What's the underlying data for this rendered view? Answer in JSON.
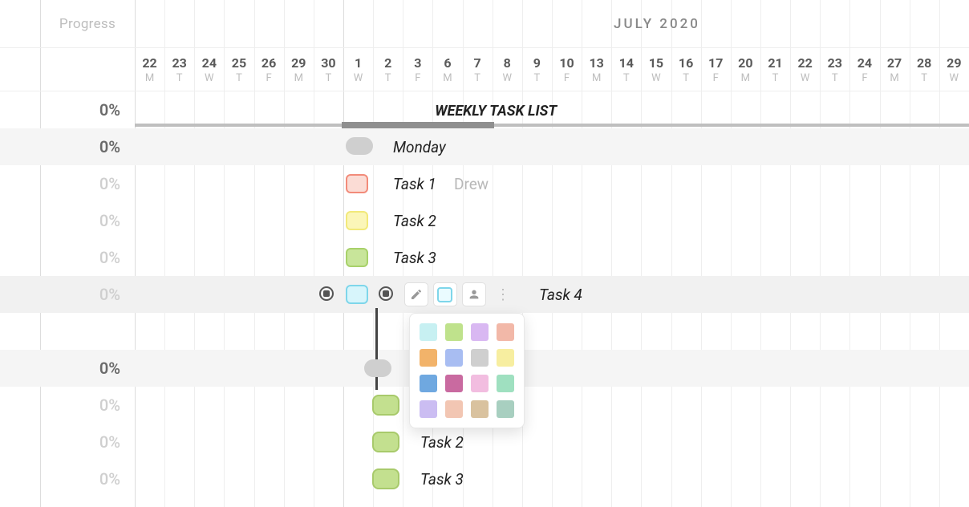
{
  "header": {
    "progress_label": "Progress",
    "month_label": "JULY 2020"
  },
  "dates": [
    {
      "num": "22",
      "dow": "M"
    },
    {
      "num": "23",
      "dow": "T"
    },
    {
      "num": "24",
      "dow": "W"
    },
    {
      "num": "25",
      "dow": "T"
    },
    {
      "num": "26",
      "dow": "F"
    },
    {
      "num": "29",
      "dow": "M"
    },
    {
      "num": "30",
      "dow": "T"
    },
    {
      "num": "1",
      "dow": "W"
    },
    {
      "num": "2",
      "dow": "T"
    },
    {
      "num": "3",
      "dow": "F"
    },
    {
      "num": "6",
      "dow": "M"
    },
    {
      "num": "7",
      "dow": "T"
    },
    {
      "num": "8",
      "dow": "W"
    },
    {
      "num": "9",
      "dow": "T"
    },
    {
      "num": "10",
      "dow": "F"
    },
    {
      "num": "13",
      "dow": "M"
    },
    {
      "num": "14",
      "dow": "T"
    },
    {
      "num": "15",
      "dow": "W"
    },
    {
      "num": "16",
      "dow": "T"
    },
    {
      "num": "17",
      "dow": "F"
    },
    {
      "num": "20",
      "dow": "M"
    },
    {
      "num": "21",
      "dow": "T"
    },
    {
      "num": "22",
      "dow": "W"
    },
    {
      "num": "23",
      "dow": "T"
    },
    {
      "num": "24",
      "dow": "F"
    },
    {
      "num": "27",
      "dow": "M"
    },
    {
      "num": "28",
      "dow": "T"
    },
    {
      "num": "29",
      "dow": "W"
    }
  ],
  "rows": [
    {
      "progress": "0%",
      "faded": false,
      "shade": false
    },
    {
      "progress": "0%",
      "faded": false,
      "shade": true
    },
    {
      "progress": "0%",
      "faded": true,
      "shade": false
    },
    {
      "progress": "0%",
      "faded": true,
      "shade": false
    },
    {
      "progress": "0%",
      "faded": true,
      "shade": false
    },
    {
      "progress": "0%",
      "faded": true,
      "shade": false
    },
    {
      "progress": "",
      "faded": true,
      "shade": false
    },
    {
      "progress": "0%",
      "faded": false,
      "shade": true
    },
    {
      "progress": "0%",
      "faded": true,
      "shade": false
    },
    {
      "progress": "0%",
      "faded": true,
      "shade": false
    },
    {
      "progress": "0%",
      "faded": true,
      "shade": false
    }
  ],
  "gantt": {
    "group_title": "WEEKLY TASK LIST",
    "tasks1": [
      {
        "label": "Monday",
        "color": "gray",
        "assignee": ""
      },
      {
        "label": "Task 1",
        "color": "red",
        "assignee": "Drew"
      },
      {
        "label": "Task 2",
        "color": "yellow",
        "assignee": ""
      },
      {
        "label": "Task 3",
        "color": "green",
        "assignee": ""
      },
      {
        "label": "Task 4",
        "color": "cyan",
        "assignee": ""
      }
    ],
    "tasks2": [
      {
        "label": "",
        "color": "green"
      },
      {
        "label": "Task 2",
        "color": "green"
      },
      {
        "label": "Task 3",
        "color": "green"
      }
    ]
  },
  "color_picker": {
    "swatches": [
      "#c7f0f2",
      "#bfe28c",
      "#d9b8f2",
      "#f2b8a8",
      "#f2b36a",
      "#a8bdf2",
      "#cfcfcf",
      "#f7eea0",
      "#6fa8e0",
      "#c96aa0",
      "#f2bde0",
      "#9fe0c0",
      "#cbbdf2",
      "#f2c6b3",
      "#d9c29f",
      "#a8cfc0"
    ]
  }
}
